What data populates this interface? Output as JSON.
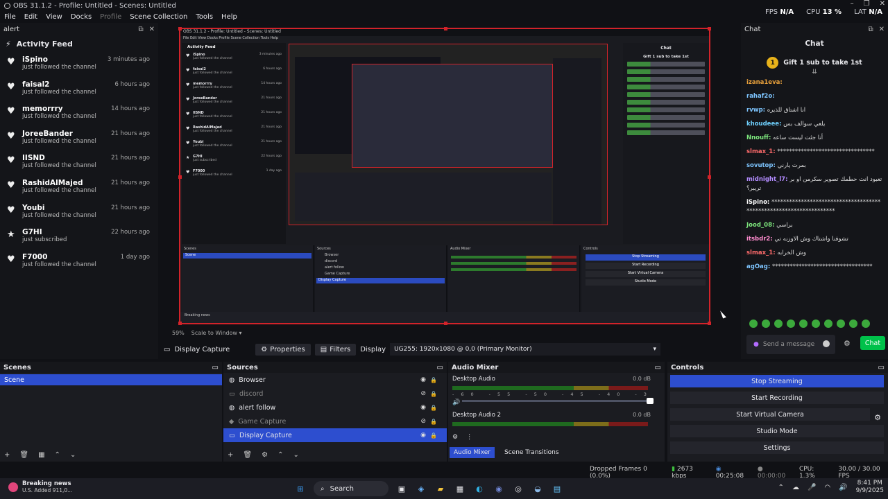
{
  "window": {
    "title": "OBS 31.1.2 - Profile: Untitled - Scenes: Untitled"
  },
  "menu": [
    "File",
    "Edit",
    "View",
    "Docks",
    "Profile",
    "Scene Collection",
    "Tools",
    "Help"
  ],
  "stats": {
    "fps_label": "FPS",
    "fps_value": "N/A",
    "cpu_label": "CPU",
    "cpu_value": "13 %",
    "lat_label": "LAT",
    "lat_value": "N/A"
  },
  "alert_dock": {
    "title": "alert",
    "feed_title": "Activity Feed",
    "items": [
      {
        "name": "iSpino",
        "action": "just followed the channel",
        "time": "3 minutes ago",
        "icon": "heart"
      },
      {
        "name": "faisal2",
        "action": "just followed the channel",
        "time": "6 hours ago",
        "icon": "heart"
      },
      {
        "name": "memorrry",
        "action": "just followed the channel",
        "time": "14 hours ago",
        "icon": "heart"
      },
      {
        "name": "JoreeBander",
        "action": "just followed the channel",
        "time": "21 hours ago",
        "icon": "heart"
      },
      {
        "name": "IISND",
        "action": "just followed the channel",
        "time": "21 hours ago",
        "icon": "heart"
      },
      {
        "name": "RashidAlMajed",
        "action": "just followed the channel",
        "time": "21 hours ago",
        "icon": "heart"
      },
      {
        "name": "Youbi",
        "action": "just followed the channel",
        "time": "21 hours ago",
        "icon": "heart"
      },
      {
        "name": "G7HI",
        "action": "just subscribed",
        "time": "22 hours ago",
        "icon": "star"
      },
      {
        "name": "F7000",
        "action": "just followed the channel",
        "time": "1 day ago",
        "icon": "heart"
      }
    ]
  },
  "preview": {
    "zoom": "59%",
    "scale_mode": "Scale to Window",
    "mini_title": "OBS 31.1.2 - Profile: Untitled - Scenes: Untitled",
    "mini_menu": "File  Edit  View  Docks  Profile  Scene Collection  Tools  Help",
    "mini_feed": "Activity Feed",
    "mini_docks": {
      "scenes": "Scenes",
      "sources": "Sources",
      "mixer": "Audio Mixer",
      "controls": "Controls"
    },
    "mini_news": "Breaking news"
  },
  "chat_dock": {
    "title": "Chat",
    "header": "Chat",
    "gift_text": "Gift 1 sub to take 1st",
    "messages": [
      {
        "user": "izana1eva:",
        "text": "",
        "color": "#e8a03b"
      },
      {
        "user": "rahaf2o:",
        "text": "",
        "color": "#7ec5ff"
      },
      {
        "user": "rvwp:",
        "text": "انا اشتاق للذيره",
        "color": "#7ec5ff"
      },
      {
        "user": "khoudeee:",
        "text": "يلعي سوالف بس",
        "color": "#6fd1ff"
      },
      {
        "user": "Nnouff:",
        "text": "أنا جئت ليست ساعه",
        "color": "#7ee87e"
      },
      {
        "user": "slmax_1:",
        "text": "*********************************",
        "color": "#ff6b6b"
      },
      {
        "user": "sovutop:",
        "text": "بمرت يارني",
        "color": "#7ec5ff"
      },
      {
        "user": "midnight_l7:",
        "text": "تعبود انت حطمك تصوير سكرمن او برتريبر؟",
        "color": "#b38cff"
      },
      {
        "user": "iSpino:",
        "text": "*******************************************************************",
        "color": "#ffffff"
      },
      {
        "user": "Jood_08:",
        "text": "براسي",
        "color": "#7ee87e"
      },
      {
        "user": "itsbdr2:",
        "text": "تشوفنا واشتاك وش الاوزنه تي",
        "color": "#ff8ccf"
      },
      {
        "user": "slmax_1:",
        "text": "وش الخرابه",
        "color": "#ff6b6b"
      },
      {
        "user": "agOag:",
        "text": "**********************************",
        "color": "#7ec5ff"
      }
    ],
    "input_placeholder": "Send a message",
    "send_label": "Chat"
  },
  "source_toolbar": {
    "source_name": "Display Capture",
    "properties": "Properties",
    "filters": "Filters",
    "display_label": "Display",
    "display_value": "UG255: 1920x1080 @ 0,0 (Primary Monitor)"
  },
  "scenes": {
    "title": "Scenes",
    "items": [
      "Scene"
    ]
  },
  "sources": {
    "title": "Sources",
    "items": [
      {
        "name": "Browser",
        "visible": true,
        "dim": false,
        "icon": "browser"
      },
      {
        "name": "discord",
        "visible": false,
        "dim": true,
        "icon": "window"
      },
      {
        "name": "alert follow",
        "visible": true,
        "dim": false,
        "icon": "browser"
      },
      {
        "name": "Game Capture",
        "visible": false,
        "dim": true,
        "icon": "game"
      },
      {
        "name": "Display Capture",
        "visible": true,
        "dim": false,
        "icon": "monitor"
      }
    ]
  },
  "mixer": {
    "title": "Audio Mixer",
    "channels": [
      {
        "name": "Desktop Audio",
        "db": "0.0 dB"
      },
      {
        "name": "Desktop Audio 2",
        "db": "0.0 dB"
      }
    ],
    "ticks": "-60 -55 -50 -45 -40 -35 -30 -25 -20 -15 -10 -5 0",
    "tab_mixer": "Audio Mixer",
    "tab_transitions": "Scene Transitions"
  },
  "controls": {
    "title": "Controls",
    "buttons": [
      "Stop Streaming",
      "Start Recording",
      "Start Virtual Camera",
      "Studio Mode",
      "Settings"
    ]
  },
  "status": {
    "dropped": "Dropped Frames 0 (0.0%)",
    "kbps": "2673 kbps",
    "stream_time": "00:25:08",
    "rec_time": "00:00:00",
    "cpu": "CPU: 1.3%",
    "fps": "30.00 / 30.00 FPS"
  },
  "taskbar": {
    "news_title": "Breaking news",
    "news_sub": "U.S. Added 911,0...",
    "search": "Search",
    "time": "8:41 PM",
    "date": "9/9/2025"
  }
}
